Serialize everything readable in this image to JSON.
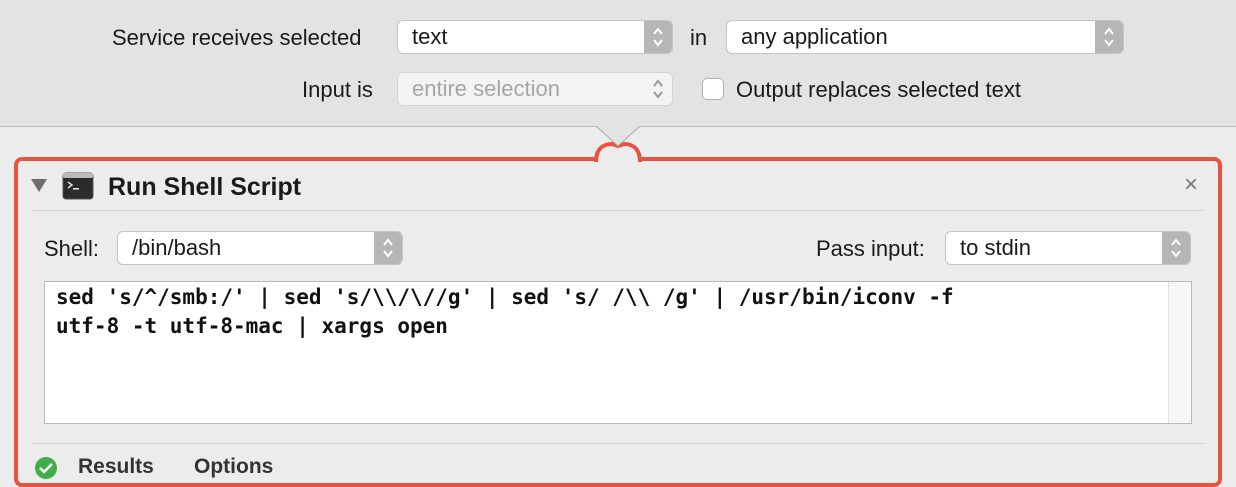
{
  "service": {
    "receives_label": "Service receives selected",
    "receives_value": "text",
    "in_label": "in",
    "app_value": "any application",
    "input_is_label": "Input is",
    "input_is_value": "entire selection",
    "output_replaces_label": "Output replaces selected text",
    "output_replaces_checked": false
  },
  "action": {
    "title": "Run Shell Script",
    "close_glyph": "×",
    "shell_label": "Shell:",
    "shell_value": "/bin/bash",
    "pass_input_label": "Pass input:",
    "pass_input_value": "to stdin",
    "script": "sed 's/^/smb:/' | sed 's/\\\\/\\//g' | sed 's/ /\\\\ /g' | /usr/bin/iconv -f\nutf-8 -t utf-8-mac | xargs open",
    "tabs": {
      "results": "Results",
      "options": "Options"
    }
  },
  "colors": {
    "accent_border": "#e8533f",
    "status_ok": "#3fae49"
  }
}
